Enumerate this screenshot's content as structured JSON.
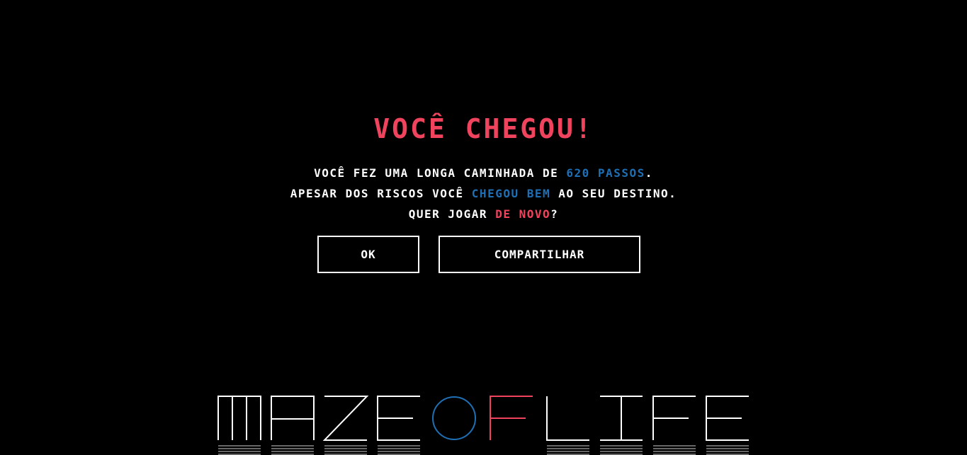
{
  "dialog": {
    "title": "Você chegou!",
    "line1_a": "Você fez uma longa caminhada de ",
    "line1_b": "620 passos",
    "line1_c": ".",
    "line2_a": "Apesar dos riscos você ",
    "line2_b": "chegou bem",
    "line2_c": " ao seu destino.",
    "line3_a": "Quer jogar ",
    "line3_b": "de novo",
    "line3_c": "?",
    "ok_label": "OK",
    "share_label": "Compartilhar"
  },
  "logo": {
    "text": "MAZE OF LIFE",
    "colors": {
      "primary": "#ffffff",
      "of_o": "#1f6fb4",
      "of_f": "#f0445e"
    }
  },
  "colors": {
    "background": "#000000",
    "accent_red": "#f0445e",
    "accent_blue": "#1f6fb4"
  }
}
